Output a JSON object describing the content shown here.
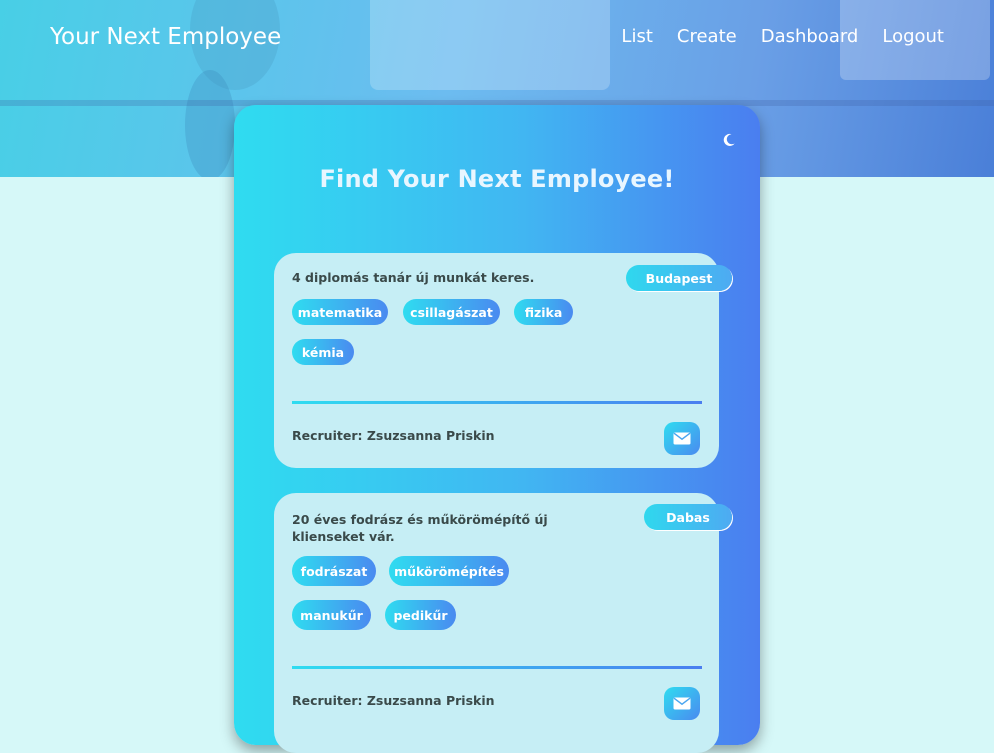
{
  "header": {
    "brand": "Your Next Employee",
    "nav": [
      "List",
      "Create",
      "Dashboard",
      "Logout"
    ]
  },
  "main": {
    "title": "Find Your Next Employee!",
    "theme_toggle_icon": "moon-icon"
  },
  "jobs": [
    {
      "description": "4 diplomás tanár új munkát keres.",
      "location": "Budapest",
      "tags": [
        "matematika",
        "csillagászat",
        "fizika",
        "kémia"
      ],
      "recruiter": "Recruiter: Zsuzsanna Priskin",
      "contact_icon": "envelope-icon"
    },
    {
      "description": "20 éves fodrász és műkörömépítő új klienseket vár.",
      "location": "Dabas",
      "tags": [
        "fodrászat",
        "műkörömépítés",
        "manukűr",
        "pedikűr"
      ],
      "recruiter": "Recruiter: Zsuzsanna Priskin",
      "contact_icon": "envelope-icon"
    }
  ],
  "colors": {
    "accent_cyan": "#2fdcf0",
    "accent_blue": "#4a7ef0",
    "page_bg": "#d6f8f8",
    "card_bg": "#c6eef5"
  }
}
